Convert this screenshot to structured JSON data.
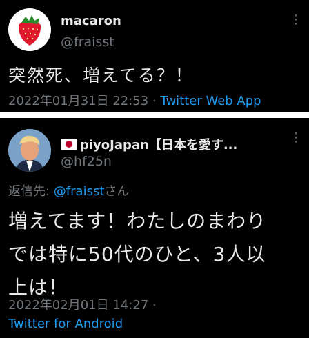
{
  "tweets": [
    {
      "display_name": "macaron",
      "handle": "@fraisst",
      "text": "突然死、増えてる？！",
      "date": "2022年01月31日 22:53",
      "separator": "·",
      "source": "Twitter Web App",
      "avatar_icon": "strawberry-icon",
      "more_icon": "more-vertical-icon"
    },
    {
      "flag_icon": "japan-flag-icon",
      "display_name": "piyoJapan【日本を愛す...",
      "handle": "@hf25n",
      "reply_prefix": "返信先: ",
      "reply_mention": "@fraisst",
      "reply_suffix": "さん",
      "text_lines": [
        "増えてます！わたしのまわり",
        "では特に50代のひと、3人以",
        "上は！"
      ],
      "date": "2022年02月01日 14:27",
      "separator": "·",
      "source": "Twitter for Android",
      "avatar_icon": "portrait-avatar",
      "more_icon": "more-vertical-icon"
    }
  ],
  "colors": {
    "background": "#000000",
    "text": "#e7e9ea",
    "muted": "#71767b",
    "link": "#1d9bf0",
    "divider": "#ffffff"
  }
}
